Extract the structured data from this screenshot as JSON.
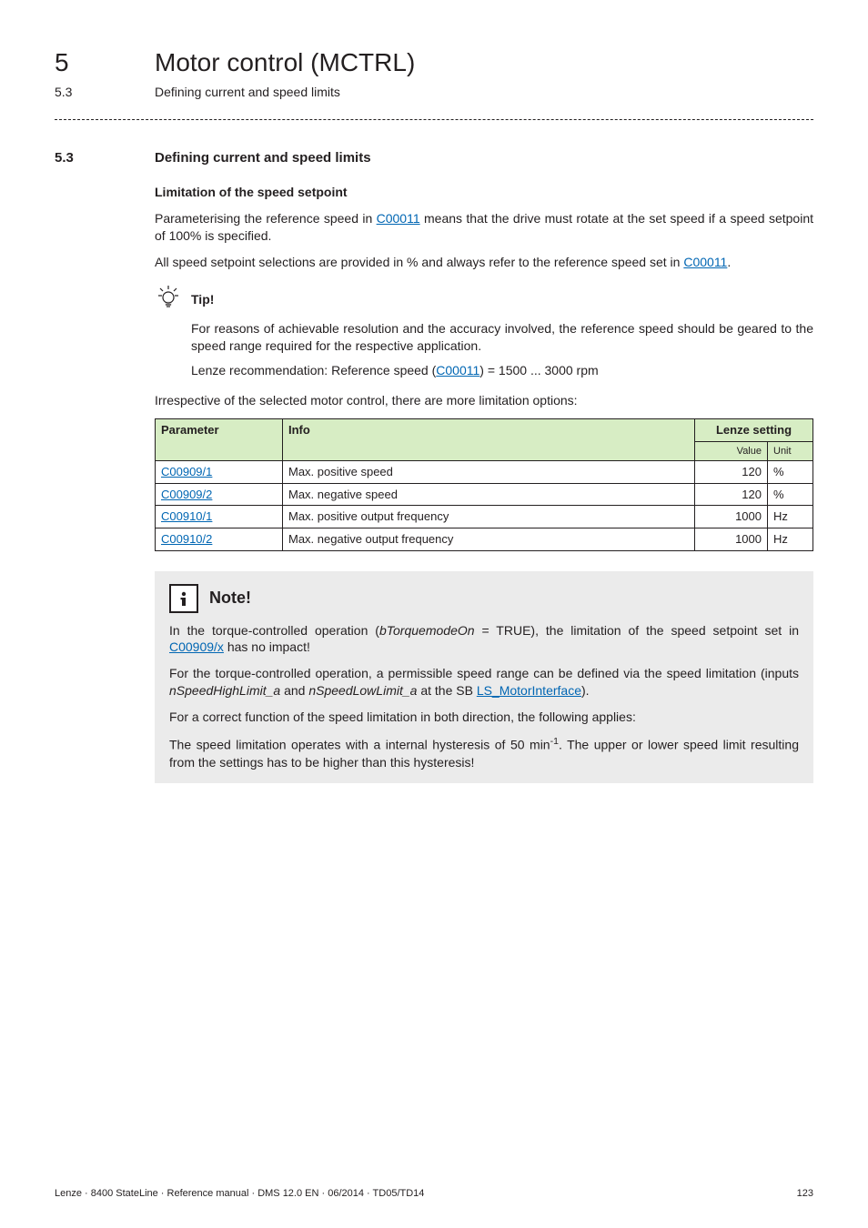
{
  "header": {
    "chapter_num": "5",
    "chapter_title": "Motor control (MCTRL)",
    "subhead_num": "5.3",
    "subhead_title": "Defining current and speed limits"
  },
  "section": {
    "num": "5.3",
    "title": "Defining current and speed limits"
  },
  "body": {
    "heading_limitation": "Limitation of the speed setpoint",
    "p1_a": "Parameterising the reference speed in ",
    "p1_link": "C00011",
    "p1_b": " means that the drive must rotate at the set speed if a speed setpoint of 100% is specified.",
    "p2_a": "All speed setpoint selections are provided in % and always refer to the reference speed set in ",
    "p2_link": "C00011",
    "p2_b": "."
  },
  "tip": {
    "label": "Tip!",
    "p1": "For reasons of achievable resolution and the accuracy involved, the reference speed should be geared to the speed range required for the respective application.",
    "p2_a": "Lenze recommendation: Reference speed (",
    "p2_link": "C00011",
    "p2_b": ") = 1500 ... 3000 rpm"
  },
  "table_intro": "Irrespective of the selected motor control, there are more limitation options:",
  "table": {
    "head_param": "Parameter",
    "head_info": "Info",
    "head_lenze": "Lenze setting",
    "head_value": "Value",
    "head_unit": "Unit",
    "rows": [
      {
        "param": "C00909/1",
        "info": "Max. positive speed",
        "value": "120",
        "unit": "%"
      },
      {
        "param": "C00909/2",
        "info": "Max. negative speed",
        "value": "120",
        "unit": "%"
      },
      {
        "param": "C00910/1",
        "info": "Max. positive output frequency",
        "value": "1000",
        "unit": "Hz"
      },
      {
        "param": "C00910/2",
        "info": "Max. negative output frequency",
        "value": "1000",
        "unit": "Hz"
      }
    ]
  },
  "note": {
    "label": "Note!",
    "p1_a": "In the torque-controlled operation (",
    "p1_var1": "bTorquemodeOn",
    "p1_b": " = TRUE), the limitation of the speed setpoint set in ",
    "p1_link": "C00909/x",
    "p1_c": " has no impact!",
    "p2_a": "For the torque-controlled operation, a permissible speed range can be defined via the speed limitation (inputs ",
    "p2_var1": "nSpeedHighLimit_a",
    "p2_b": " and ",
    "p2_var2": "nSpeedLowLimit_a",
    "p2_c": " at the SB ",
    "p2_link": "LS_MotorInterface",
    "p2_d": ").",
    "p3": "For a correct function of the speed limitation in both direction, the following applies:",
    "p4_a": "The speed limitation operates with a internal hysteresis of 50 min",
    "p4_sup": "-1",
    "p4_b": ". The upper or lower speed limit resulting from the settings has to be higher than this hysteresis!"
  },
  "footer": {
    "left": "Lenze · 8400 StateLine · Reference manual · DMS 12.0 EN · 06/2014 · TD05/TD14",
    "right": "123"
  }
}
